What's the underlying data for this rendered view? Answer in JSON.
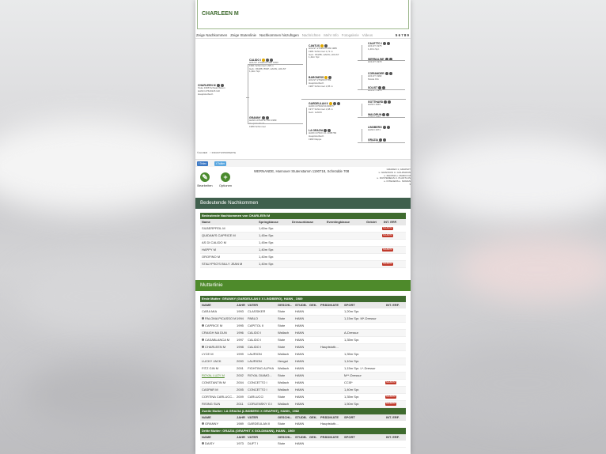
{
  "horse_name": "CHARLEEN M",
  "tabs": [
    "Zeige Nachkommen",
    "Zeige Stutenlinie",
    "Nachkommen hinzufügen",
    "Nachrichten",
    "Mehr Info",
    "Fotogalerie",
    "Videos"
  ],
  "tabs_pages": "5 6 7 8 9",
  "pedigree": {
    "horse": {
      "name": "CHARLEEN M",
      "info": "Stute 1998 Schwarzbraun\nHANN 27620115 GR\nHauptstutbuch"
    },
    "sire": {
      "name": "CALIDO I",
      "info": "HOLST 27620/37789/ 1993\n1991 Schimmel 1,68 m\nGeb.: 8KWB, BWP, HANN, HOLST\n1,4km Spr."
    },
    "dam": {
      "name": "GRANNY",
      "info": "HANN 27620 37700 1989\nHauptstutbuch\n1989 Schimmel"
    },
    "ss": {
      "name": "CANTUS",
      "info": "HOLST 27620/37199 1989\n1981 Schimmel 1,71 m\nGeb.: 8KWB, HANN, HOLST\n1,4km Spr."
    },
    "sd": {
      "name": "BARONESS",
      "info": "HOLST 27620/37789\nHauptstutbuch\n1987 Schimmel 1,65 m"
    },
    "ds": {
      "name": "GARDEULAN II",
      "info": "HANN 27620/1/1330077\n1977 Schimmel 1,68 m\nGeb.: HANN"
    },
    "dd": {
      "name": "LA GRAZIA",
      "info": "HANN 27620 1/1 1005766\nHauptstutbuch\n1982 Rappe"
    },
    "g4": [
      {
        "name": "CALETTO I",
        "info": "HOLST 1975\n1,40m Spr."
      },
      {
        "name": "WERNALINE",
        "info": "HOLST 1979"
      },
      {
        "name": "CORIANDER",
        "info": "HOLST 1982\nNicole Flix"
      },
      {
        "name": "SOLIST",
        "info": "HOLST 1979"
      },
      {
        "name": "GOTTHARD",
        "info": "HANN 1949"
      },
      {
        "name": "WALDRUN",
        "info": "HANN 1966"
      },
      {
        "name": "LINDBERG",
        "info": "HANN 1971"
      },
      {
        "name": "GRAZIA",
        "info": "HANN 1969"
      }
    ]
  },
  "legend": [
    "ELDER",
    "INDUKTIVPROPERTE"
  ],
  "share": [
    "Teilen",
    "Twitter"
  ],
  "actions": {
    "edit": "Bearbeiten",
    "options": "Optionen"
  },
  "info_line": "WERNANDE, Hannover Stutenstamm 1190718, Schnödde 708",
  "info_right": [
    "GRADEN 1, GRAPHIT",
    "u. GRANNUS U. GOLDMANN",
    "u. MAXIMA u. MARCO M",
    "u. DUSTEMEGS U. PLANTLUS",
    "u. INTECENS u. NOMAN"
  ],
  "offspring": {
    "section_title": "Bedeutende Nachkommen",
    "caption": "Bedeutende Nachkommen von CHARLEEN M",
    "headers": [
      "Name",
      "Springklasse",
      "Dressurklasse",
      "Eventingklasse",
      "Gekört",
      "INT. ERF."
    ],
    "rows": [
      {
        "name": "SILBERPFEIL M",
        "spring": "1,60m Spr.",
        "badge": "SCHWITZ"
      },
      {
        "name": "QUIDAM'S CAPRICE M",
        "spring": "1,45m Spr.",
        "badge": "SCHWITZ"
      },
      {
        "name": "AS DI CALIDO M",
        "spring": "1,45m Spr.",
        "badge": ""
      },
      {
        "name": "HAPPY M",
        "spring": "1,40m Spr.",
        "badge": "SCHWITZ"
      },
      {
        "name": "OROFINO M",
        "spring": "1,40m Spr.",
        "badge": ""
      },
      {
        "name": "STALYPSO'S BILLY JEAN M",
        "spring": "1,40m Spr.",
        "badge": "SCHWITZ"
      }
    ]
  },
  "damline": {
    "section_title": "Mutterlinie",
    "first_caption": "Erste Mutter: GRANNY (GARDEULAN II X LINDBERG), HANN , 1989",
    "headers": [
      "NAME",
      "JAHR",
      "VATER",
      "GESCHL.",
      "STUDB.",
      "GEK.",
      "PRÄDIKATE",
      "SPORT",
      "INT. ERF."
    ],
    "first_rows": [
      {
        "name": "CARA MIA",
        "year": "1993",
        "sire": "CLASSIKER",
        "sex": "Stute",
        "studb": "HANN",
        "pred": "",
        "sport": "1,20m Spr.",
        "badge": "",
        "dot": false,
        "link": false
      },
      {
        "name": "PALOMA PICASSO M",
        "year": "1994",
        "sire": "PABLO",
        "sex": "Stute",
        "studb": "HANN",
        "pred": "",
        "sport": "1,15m Spr. M*-Dressur",
        "badge": "",
        "dot": true,
        "link": false
      },
      {
        "name": "CAPRICE M",
        "year": "1995",
        "sire": "CAPITOL II",
        "sex": "Stute",
        "studb": "HANN",
        "pred": "",
        "sport": "",
        "badge": "",
        "dot": true,
        "link": false
      },
      {
        "name": "CRAIGH NA DUN",
        "year": "1996",
        "sire": "CALIDO I",
        "sex": "Wallach",
        "studb": "HANN",
        "pred": "",
        "sport": "A-Dressur",
        "badge": "",
        "dot": false,
        "link": false
      },
      {
        "name": "CASABLANCA M",
        "year": "1997",
        "sire": "CALIDO I",
        "sex": "Stute",
        "studb": "HANN",
        "pred": "",
        "sport": "1,35m Spr.",
        "badge": "",
        "dot": true,
        "link": false
      },
      {
        "name": "CHARLEEN M",
        "year": "1998",
        "sire": "CALIDO I",
        "sex": "Stute",
        "studb": "HANN",
        "pred": "Hauptstutb...",
        "sport": "",
        "badge": "",
        "dot": true,
        "link": false
      },
      {
        "name": "LYCE M",
        "year": "1999",
        "sire": "LAURION",
        "sex": "Wallach",
        "studb": "HANN",
        "pred": "",
        "sport": "1,35m Spr.",
        "badge": "",
        "dot": false,
        "link": false
      },
      {
        "name": "LUCKY JACK",
        "year": "2000",
        "sire": "LAURION",
        "sex": "Hengst",
        "studb": "HANN",
        "pred": "",
        "sport": "1,10m Spr.",
        "badge": "",
        "dot": false,
        "link": false
      },
      {
        "name": "FITZ GIN M",
        "year": "2001",
        "sire": "FIGHTING ALPHA",
        "sex": "Wallach",
        "studb": "HANN",
        "pred": "",
        "sport": "1,15m Spr. L*-Dressur",
        "badge": "",
        "dot": false,
        "link": false
      },
      {
        "name": "ROYAL LUZY M",
        "year": "2002",
        "sire": "ROYAL DIAMO...",
        "sex": "Stute",
        "studb": "HANN",
        "pred": "",
        "sport": "M**-Dressur",
        "badge": "",
        "dot": false,
        "link": true
      },
      {
        "name": "CONSTANTIN M",
        "year": "2004",
        "sire": "CONCETTO I",
        "sex": "Wallach",
        "studb": "HANN",
        "pred": "",
        "sport": "CCI5*",
        "badge": "SCHWITZ",
        "dot": false,
        "link": false
      },
      {
        "name": "CASPAR M",
        "year": "2005",
        "sire": "CONCETTO I",
        "sex": "Wallach",
        "studb": "HANN",
        "pred": "",
        "sport": "1,40m Spr.",
        "badge": "",
        "dot": false,
        "link": false
      },
      {
        "name": "CORTINA CARLUCC...",
        "year": "2009",
        "sire": "CARLUCCI",
        "sex": "Stute",
        "studb": "HANN",
        "pred": "",
        "sport": "1,35m Spr.",
        "badge": "SCHWITZ",
        "dot": false,
        "link": false
      },
      {
        "name": "RISING SUN",
        "year": "2011",
        "sire": "CORLENSKY G I",
        "sex": "Wallach",
        "studb": "HANN",
        "pred": "",
        "sport": "1,50m Spr.",
        "badge": "SCHWITZ",
        "dot": false,
        "link": false
      }
    ],
    "second_caption": "Zweite Mutter: LA GRAZIA (LINDBERG X GRAPHIT), HANN , 1982",
    "second_rows": [
      {
        "name": "GRANNY",
        "year": "1989",
        "sire": "GARDEULAN II",
        "sex": "Stute",
        "studb": "HANN",
        "pred": "Hauptstutb...",
        "sport": "",
        "badge": "",
        "dot": true,
        "link": false
      }
    ],
    "third_caption": "Dritte Mutter: GRAZIA (GRAPHIT X GOLDMANN), HANN , 1969",
    "third_rows": [
      {
        "name": "DAISY",
        "year": "1973",
        "sire": "DUFT I",
        "sex": "Stute",
        "studb": "HANN",
        "pred": "",
        "sport": "",
        "badge": "",
        "dot": true,
        "link": false
      }
    ]
  }
}
